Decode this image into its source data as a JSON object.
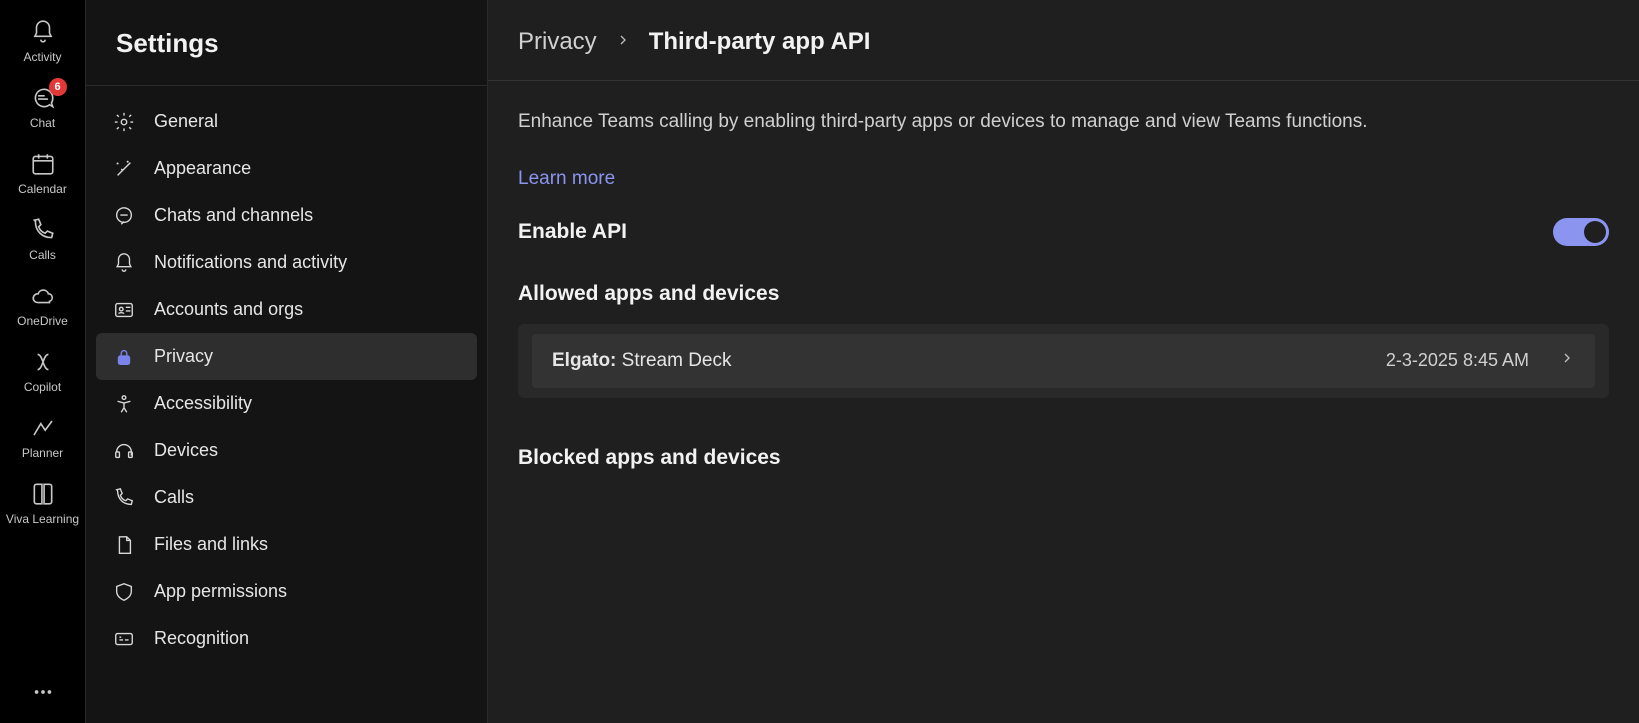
{
  "rail": {
    "items": [
      {
        "label": "Activity"
      },
      {
        "label": "Chat",
        "badge": "6"
      },
      {
        "label": "Calendar"
      },
      {
        "label": "Calls"
      },
      {
        "label": "OneDrive"
      },
      {
        "label": "Copilot"
      },
      {
        "label": "Planner"
      },
      {
        "label": "Viva Learning"
      }
    ]
  },
  "sidebar": {
    "title": "Settings",
    "items": [
      {
        "label": "General"
      },
      {
        "label": "Appearance"
      },
      {
        "label": "Chats and channels"
      },
      {
        "label": "Notifications and activity"
      },
      {
        "label": "Accounts and orgs"
      },
      {
        "label": "Privacy"
      },
      {
        "label": "Accessibility"
      },
      {
        "label": "Devices"
      },
      {
        "label": "Calls"
      },
      {
        "label": "Files and links"
      },
      {
        "label": "App permissions"
      },
      {
        "label": "Recognition"
      }
    ]
  },
  "main": {
    "breadcrumb": {
      "parent": "Privacy",
      "current": "Third-party app API"
    },
    "description": "Enhance Teams calling by enabling third-party apps or devices to manage and view Teams functions.",
    "learn_more": "Learn more",
    "enable_api_label": "Enable API",
    "allowed_title": "Allowed apps and devices",
    "blocked_title": "Blocked apps and devices",
    "allowed_items": [
      {
        "vendor": "Elgato:",
        "name": "Stream Deck",
        "timestamp": "2-3-2025 8:45 AM"
      }
    ],
    "colors": {
      "accent": "#8b95f0",
      "badge": "#e23838"
    }
  }
}
